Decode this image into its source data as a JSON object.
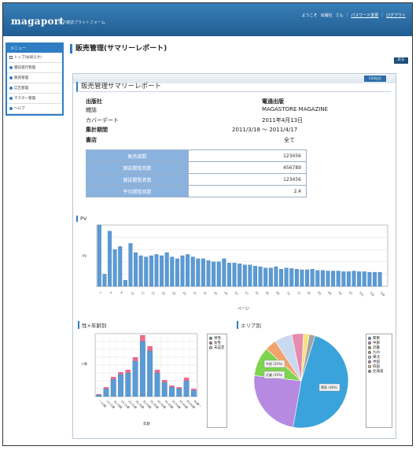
{
  "header": {
    "logo": "magaport",
    "logo_sub": "電子雑誌プラットフォーム",
    "welcome": "ようこそ",
    "user": "出版社",
    "honorific": "さん",
    "password_link": "パスワード変更",
    "logout_link": "ログアウト"
  },
  "sidebar": {
    "title": "メニュー",
    "items": [
      {
        "label": "トップ(お知らせ)",
        "icon": "checkbox-icon"
      },
      {
        "label": "雑誌進行管理",
        "icon": "dot-icon"
      },
      {
        "label": "販売管理",
        "icon": "dot-icon"
      },
      {
        "label": "広告管理",
        "icon": "dot-icon"
      },
      {
        "label": "マスター管理",
        "icon": "dot-icon"
      },
      {
        "label": "ヘルプ",
        "icon": "dot-icon"
      }
    ]
  },
  "page_title": "販売管理(サマリーレポート)",
  "back_button": "戻る",
  "report": {
    "output_button": "CSV出力",
    "title": "販売管理サマリーレポート",
    "info": [
      {
        "label": "出版社",
        "value": "電通出版"
      },
      {
        "label": "雑誌",
        "value": "MAGASTORE MAGAZINE"
      },
      {
        "label": "カバーデート",
        "value": "2011年4月13日"
      },
      {
        "label": "集計期間",
        "value": "2011/3/18 ～ 2011/4/17"
      },
      {
        "label": "書店",
        "value": "全て"
      }
    ],
    "stats": [
      {
        "label": "販売部数",
        "value": "123456"
      },
      {
        "label": "雑誌閲覧回数",
        "value": "456789"
      },
      {
        "label": "雑誌閲覧者数",
        "value": "123456"
      },
      {
        "label": "平均閲覧回数",
        "value": "2.4"
      }
    ]
  },
  "colors": {
    "accent": "#2f7ec4",
    "bar": "#5b9bd5",
    "bar_top": "#e86b8a"
  },
  "chart_data": [
    {
      "type": "bar",
      "title": "PV",
      "xlabel": "ページ",
      "ylabel": "PV",
      "categories": [
        "1",
        "3",
        "5",
        "7",
        "9",
        "11",
        "13",
        "15",
        "17",
        "19",
        "21",
        "23",
        "25",
        "27",
        "29",
        "31",
        "33",
        "35",
        "37",
        "39",
        "41",
        "43",
        "45",
        "47",
        "49",
        "51",
        "53",
        "55",
        "57",
        "59",
        "61",
        "63",
        "65",
        "67",
        "69",
        "71",
        "73",
        "75",
        "77",
        "79",
        "81",
        "83",
        "85",
        "87",
        "89",
        "91",
        "93",
        "95",
        "97",
        "99",
        "101",
        "103",
        "105",
        "107",
        "109",
        "111"
      ],
      "values": [
        100,
        20,
        90,
        60,
        65,
        10,
        70,
        55,
        50,
        48,
        50,
        52,
        50,
        55,
        48,
        45,
        50,
        52,
        48,
        45,
        45,
        42,
        40,
        40,
        45,
        38,
        38,
        37,
        35,
        35,
        33,
        32,
        30,
        30,
        32,
        28,
        30,
        29,
        28,
        27,
        27,
        28,
        26,
        26,
        25,
        25,
        25,
        24,
        24,
        25,
        24,
        24,
        23,
        23,
        23,
        0
      ],
      "ylim": [
        0,
        100
      ],
      "grid": true
    },
    {
      "type": "bar",
      "title": "性×年齢別",
      "xlabel": "年齢",
      "ylabel": "人数",
      "categories": [
        "～12歳",
        "13-15歳",
        "16-18歳",
        "19-22歳",
        "23-25歳",
        "26-29歳",
        "30-34歳",
        "35-39歳",
        "40-44歳",
        "45-49歳",
        "50-54歳",
        "55-59歳",
        "60-64歳",
        "65歳～"
      ],
      "series": [
        {
          "name": "男性",
          "values": [
            2,
            10,
            22,
            28,
            30,
            45,
            70,
            58,
            30,
            18,
            12,
            10,
            20,
            8
          ]
        },
        {
          "name": "女性",
          "values": [
            1,
            2,
            3,
            3,
            4,
            5,
            8,
            6,
            4,
            3,
            2,
            2,
            4,
            2
          ]
        }
      ],
      "legend": [
        "男性",
        "女性",
        "未設定"
      ],
      "grid": true
    },
    {
      "type": "pie",
      "title": "エリア別",
      "labels": [
        "関東",
        "中部",
        "近畿",
        "九州",
        "東北",
        "中国",
        "四国",
        "北海道"
      ],
      "values": [
        48,
        24,
        10,
        4,
        6,
        4,
        2,
        2
      ],
      "annotations": [
        "関東 (48%)",
        "近畿 (10%)",
        "中部 (24%)"
      ],
      "legend_placement": "right"
    }
  ]
}
